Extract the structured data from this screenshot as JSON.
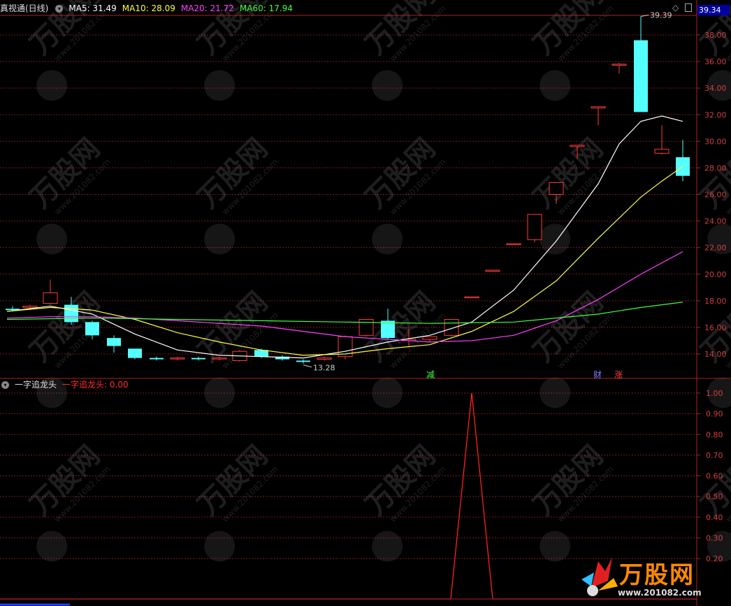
{
  "top_panel": {
    "title": "真视通(日线)",
    "ma": [
      {
        "label": "MA5: 31.49",
        "color": "#ffffff"
      },
      {
        "label": "MA10: 28.09",
        "color": "#ffff40"
      },
      {
        "label": "MA20: 21.72",
        "color": "#ff40ff"
      },
      {
        "label": "MA60: 17.94",
        "color": "#40ff40"
      }
    ],
    "current_price_badge": "39.34",
    "price_axis": [
      "38.00",
      "36.00",
      "34.00",
      "32.00",
      "30.00",
      "28.00",
      "26.00",
      "24.00",
      "22.00",
      "20.00",
      "18.00",
      "16.00",
      "14.00"
    ],
    "high_marker": "39.39",
    "low_marker": "13.28",
    "bottom_tags": [
      {
        "text": "减",
        "color": "#40ff40"
      },
      {
        "text": "财",
        "color": "#8080ff"
      },
      {
        "text": "涨",
        "color": "#ff4040"
      }
    ]
  },
  "bottom_panel": {
    "title": "一字追龙头",
    "value_label": "一字追龙头: 0.00",
    "value_axis": [
      "1.00",
      "0.90",
      "0.80",
      "0.70",
      "0.60",
      "0.50",
      "0.40",
      "0.30",
      "0.20"
    ]
  },
  "watermark": {
    "brand": "万股网",
    "url": "www.201082.com"
  },
  "colors": {
    "up": "#ff3c3c",
    "down": "#54ffff",
    "grid": "#7a1a1a",
    "frame": "#b02020",
    "ma5": "#ffffff",
    "ma10": "#ffff40",
    "ma20": "#ff40ff",
    "ma60": "#40ff40",
    "indicator": "#ff2020"
  }
}
